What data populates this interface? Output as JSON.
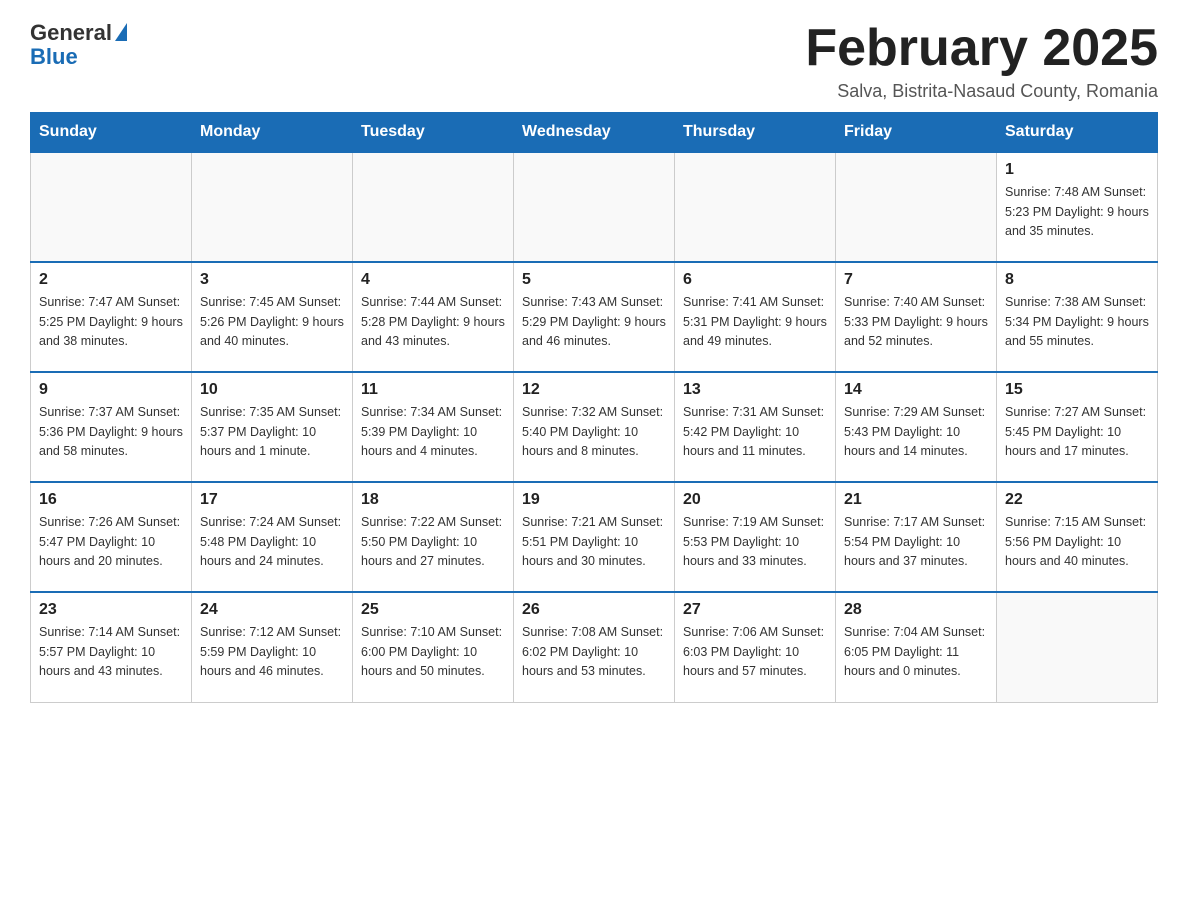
{
  "logo": {
    "general": "General",
    "blue": "Blue"
  },
  "header": {
    "month_title": "February 2025",
    "subtitle": "Salva, Bistrita-Nasaud County, Romania"
  },
  "days_of_week": [
    "Sunday",
    "Monday",
    "Tuesday",
    "Wednesday",
    "Thursday",
    "Friday",
    "Saturday"
  ],
  "weeks": [
    [
      {
        "day": "",
        "info": ""
      },
      {
        "day": "",
        "info": ""
      },
      {
        "day": "",
        "info": ""
      },
      {
        "day": "",
        "info": ""
      },
      {
        "day": "",
        "info": ""
      },
      {
        "day": "",
        "info": ""
      },
      {
        "day": "1",
        "info": "Sunrise: 7:48 AM\nSunset: 5:23 PM\nDaylight: 9 hours and 35 minutes."
      }
    ],
    [
      {
        "day": "2",
        "info": "Sunrise: 7:47 AM\nSunset: 5:25 PM\nDaylight: 9 hours and 38 minutes."
      },
      {
        "day": "3",
        "info": "Sunrise: 7:45 AM\nSunset: 5:26 PM\nDaylight: 9 hours and 40 minutes."
      },
      {
        "day": "4",
        "info": "Sunrise: 7:44 AM\nSunset: 5:28 PM\nDaylight: 9 hours and 43 minutes."
      },
      {
        "day": "5",
        "info": "Sunrise: 7:43 AM\nSunset: 5:29 PM\nDaylight: 9 hours and 46 minutes."
      },
      {
        "day": "6",
        "info": "Sunrise: 7:41 AM\nSunset: 5:31 PM\nDaylight: 9 hours and 49 minutes."
      },
      {
        "day": "7",
        "info": "Sunrise: 7:40 AM\nSunset: 5:33 PM\nDaylight: 9 hours and 52 minutes."
      },
      {
        "day": "8",
        "info": "Sunrise: 7:38 AM\nSunset: 5:34 PM\nDaylight: 9 hours and 55 minutes."
      }
    ],
    [
      {
        "day": "9",
        "info": "Sunrise: 7:37 AM\nSunset: 5:36 PM\nDaylight: 9 hours and 58 minutes."
      },
      {
        "day": "10",
        "info": "Sunrise: 7:35 AM\nSunset: 5:37 PM\nDaylight: 10 hours and 1 minute."
      },
      {
        "day": "11",
        "info": "Sunrise: 7:34 AM\nSunset: 5:39 PM\nDaylight: 10 hours and 4 minutes."
      },
      {
        "day": "12",
        "info": "Sunrise: 7:32 AM\nSunset: 5:40 PM\nDaylight: 10 hours and 8 minutes."
      },
      {
        "day": "13",
        "info": "Sunrise: 7:31 AM\nSunset: 5:42 PM\nDaylight: 10 hours and 11 minutes."
      },
      {
        "day": "14",
        "info": "Sunrise: 7:29 AM\nSunset: 5:43 PM\nDaylight: 10 hours and 14 minutes."
      },
      {
        "day": "15",
        "info": "Sunrise: 7:27 AM\nSunset: 5:45 PM\nDaylight: 10 hours and 17 minutes."
      }
    ],
    [
      {
        "day": "16",
        "info": "Sunrise: 7:26 AM\nSunset: 5:47 PM\nDaylight: 10 hours and 20 minutes."
      },
      {
        "day": "17",
        "info": "Sunrise: 7:24 AM\nSunset: 5:48 PM\nDaylight: 10 hours and 24 minutes."
      },
      {
        "day": "18",
        "info": "Sunrise: 7:22 AM\nSunset: 5:50 PM\nDaylight: 10 hours and 27 minutes."
      },
      {
        "day": "19",
        "info": "Sunrise: 7:21 AM\nSunset: 5:51 PM\nDaylight: 10 hours and 30 minutes."
      },
      {
        "day": "20",
        "info": "Sunrise: 7:19 AM\nSunset: 5:53 PM\nDaylight: 10 hours and 33 minutes."
      },
      {
        "day": "21",
        "info": "Sunrise: 7:17 AM\nSunset: 5:54 PM\nDaylight: 10 hours and 37 minutes."
      },
      {
        "day": "22",
        "info": "Sunrise: 7:15 AM\nSunset: 5:56 PM\nDaylight: 10 hours and 40 minutes."
      }
    ],
    [
      {
        "day": "23",
        "info": "Sunrise: 7:14 AM\nSunset: 5:57 PM\nDaylight: 10 hours and 43 minutes."
      },
      {
        "day": "24",
        "info": "Sunrise: 7:12 AM\nSunset: 5:59 PM\nDaylight: 10 hours and 46 minutes."
      },
      {
        "day": "25",
        "info": "Sunrise: 7:10 AM\nSunset: 6:00 PM\nDaylight: 10 hours and 50 minutes."
      },
      {
        "day": "26",
        "info": "Sunrise: 7:08 AM\nSunset: 6:02 PM\nDaylight: 10 hours and 53 minutes."
      },
      {
        "day": "27",
        "info": "Sunrise: 7:06 AM\nSunset: 6:03 PM\nDaylight: 10 hours and 57 minutes."
      },
      {
        "day": "28",
        "info": "Sunrise: 7:04 AM\nSunset: 6:05 PM\nDaylight: 11 hours and 0 minutes."
      },
      {
        "day": "",
        "info": ""
      }
    ]
  ]
}
